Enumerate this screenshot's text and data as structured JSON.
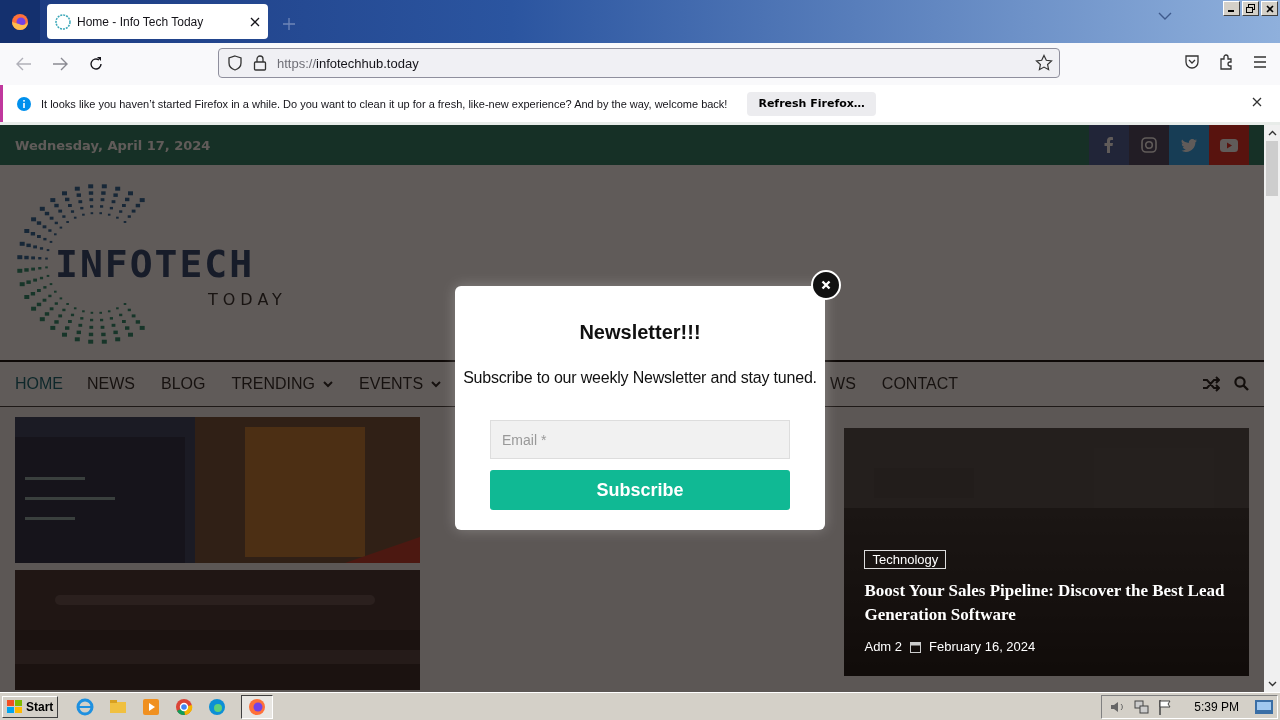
{
  "browser": {
    "tab": {
      "title": "Home - Info Tech Today",
      "selected": true
    },
    "url": {
      "scheme": "https://",
      "host": "infotechhub.today"
    },
    "notification": {
      "message": "It looks like you haven’t started Firefox in a while. Do you want to clean it up for a fresh, like-new experience? And by the way, welcome back!",
      "button": "Refresh Firefox…"
    }
  },
  "site": {
    "date": "Wednesday, April 17, 2024",
    "logo": {
      "title": "INFOTECH",
      "subtitle": "TODAY"
    },
    "nav": [
      {
        "label": "HOME",
        "selected": true,
        "dropdown": false
      },
      {
        "label": "NEWS",
        "selected": false,
        "dropdown": false
      },
      {
        "label": "BLOG",
        "selected": false,
        "dropdown": false
      },
      {
        "label": "TRENDING",
        "selected": false,
        "dropdown": true
      },
      {
        "label": "EVENTS",
        "selected": false,
        "dropdown": true
      },
      {
        "label": "WS",
        "selected": false,
        "dropdown": false
      },
      {
        "label": "CONTACT",
        "selected": false,
        "dropdown": false
      }
    ],
    "featured": {
      "category": "Technology",
      "title": "Boost Your Sales Pipeline: Discover the Best Lead Generation Software",
      "author": "Adm 2",
      "date": "February 16, 2024"
    }
  },
  "popup": {
    "title": "Newsletter!!!",
    "text": "Subscribe to our weekly Newsletter and stay tuned.",
    "email": {
      "placeholder": "Email *"
    },
    "button": "Subscribe"
  },
  "taskbar": {
    "start": "Start",
    "time": "5:39 PM"
  }
}
